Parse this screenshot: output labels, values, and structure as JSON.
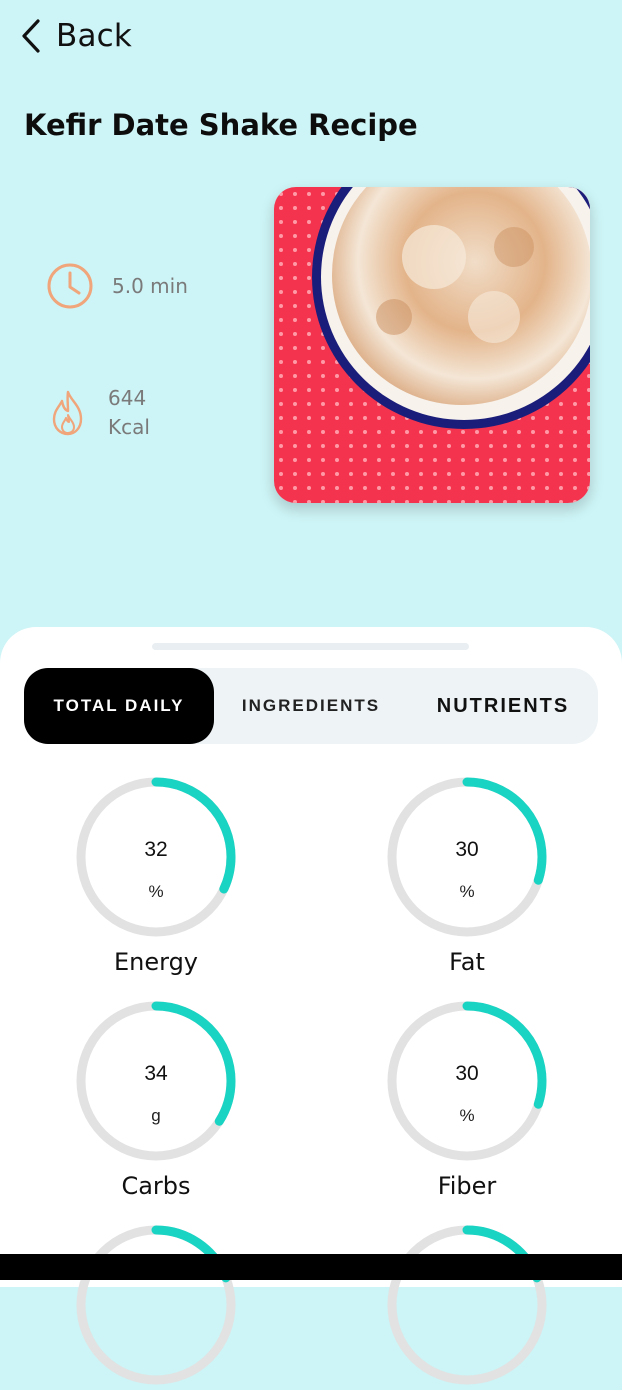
{
  "header": {
    "back_label": "Back",
    "title": "Kefir Date Shake Recipe"
  },
  "stats": {
    "time": "5.0 min",
    "kcal_value": "644",
    "kcal_unit": "Kcal"
  },
  "tabs": [
    {
      "label": "TOTAL DAILY",
      "active": true
    },
    {
      "label": "INGREDIENTS",
      "active": false
    },
    {
      "label": "NUTRIENTS",
      "active": false
    }
  ],
  "nutrients": [
    {
      "name": "Energy",
      "value": "32",
      "unit": "%",
      "progress": 0.32
    },
    {
      "name": "Fat",
      "value": "30",
      "unit": "%",
      "progress": 0.3
    },
    {
      "name": "Carbs",
      "value": "34",
      "unit": "g",
      "progress": 0.34
    },
    {
      "name": "Fiber",
      "value": "30",
      "unit": "%",
      "progress": 0.3
    }
  ],
  "colors": {
    "background": "#cdf4f6",
    "accent": "#19d3c3",
    "ring_track": "#e2e2e2",
    "icon_orange": "#f0a57a"
  },
  "icons": {
    "back": "chevron-left-icon",
    "time": "clock-icon",
    "kcal": "flame-icon"
  }
}
